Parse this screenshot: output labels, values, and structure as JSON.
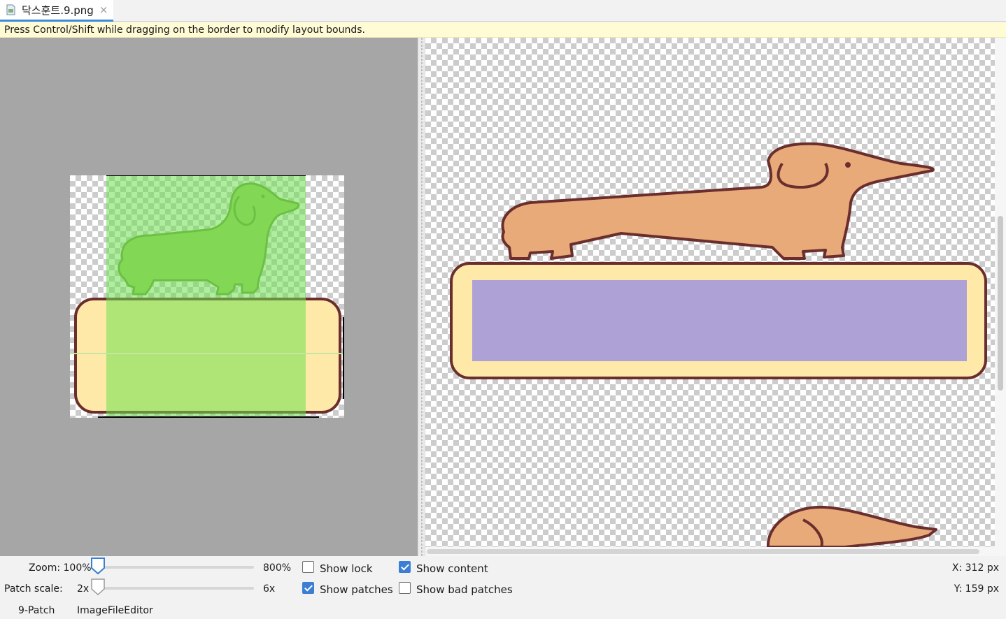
{
  "tab": {
    "title": "닥스훈트.9.png",
    "close": "×"
  },
  "hint": "Press Control/Shift while dragging on the border to modify layout bounds.",
  "controls": {
    "zoom_label": "Zoom: 100%",
    "zoom_max": "800%",
    "zoom_value_fraction": 0.0,
    "patch_scale_label": "Patch scale:",
    "patch_scale_min": "2x",
    "patch_scale_max": "6x",
    "patch_scale_value_fraction": 0.0,
    "show_lock": {
      "label": "Show lock",
      "checked": false
    },
    "show_patches": {
      "label": "Show patches",
      "checked": true
    },
    "show_content": {
      "label": "Show content",
      "checked": true
    },
    "show_bad_patches": {
      "label": "Show bad patches",
      "checked": false
    },
    "x_readout": "X: 312 px",
    "y_readout": "Y: 159 px"
  },
  "bottom_tabs": [
    "9-Patch",
    "ImageFileEditor"
  ],
  "colors": {
    "patch_green": "#8fe873",
    "body_tan": "#e8aa78",
    "outline": "#6b2e2e",
    "box_yellow": "#ffe9a8",
    "content_purple": "#ada1d5",
    "accent_blue": "#3a7fd3"
  }
}
